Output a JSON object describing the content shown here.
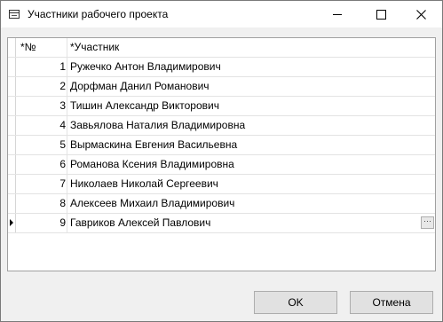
{
  "window": {
    "title": "Участники рабочего проекта",
    "icon": "window-app-icon"
  },
  "grid": {
    "columns": [
      "*№",
      "*Участник"
    ],
    "rows": [
      {
        "num": "1",
        "name": "Ружечко Антон Владимирович"
      },
      {
        "num": "2",
        "name": "Дорфман Данил Романович"
      },
      {
        "num": "3",
        "name": "Тишин Александр Викторович"
      },
      {
        "num": "4",
        "name": "Завьялова Наталия Владимировна"
      },
      {
        "num": "5",
        "name": "Вырмаскина Евгения Васильевна"
      },
      {
        "num": "6",
        "name": "Романова Ксения Владимировна"
      },
      {
        "num": "7",
        "name": "Николаев Николай Сергеевич"
      },
      {
        "num": "8",
        "name": "Алексеев Михаил Владимирович"
      },
      {
        "num": "9",
        "name": "Гавриков Алексей Павлович"
      }
    ],
    "current_row": 9,
    "ellipsis_label": "···"
  },
  "buttons": {
    "ok": "OK",
    "cancel": "Отмена"
  }
}
